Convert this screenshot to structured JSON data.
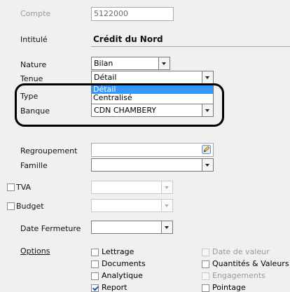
{
  "labels": {
    "compte": "Compte",
    "intitule": "Intitulé",
    "nature": "Nature",
    "tenue": "Tenue",
    "type": "Type",
    "banque": "Banque",
    "regroupement": "Regroupement",
    "famille": "Famille",
    "tva": "TVA",
    "budget": "Budget",
    "date_fermeture": "Date Fermeture",
    "options": "Options"
  },
  "values": {
    "compte": "5122000",
    "intitule": "Crédit du Nord",
    "nature": "Bilan",
    "tenue": "Détail",
    "banque": "CDN CHAMBERY"
  },
  "tenue_options": [
    "Détail",
    "Centralisé"
  ],
  "tenue_selected_index": 0,
  "options": [
    {
      "label": "Lettrage",
      "checked": false,
      "enabled": true
    },
    {
      "label": "Date de valeur",
      "checked": false,
      "enabled": false
    },
    {
      "label": "Documents",
      "checked": false,
      "enabled": true
    },
    {
      "label": "Quantités & Valeurs",
      "checked": false,
      "enabled": true
    },
    {
      "label": "Analytique",
      "checked": false,
      "enabled": true
    },
    {
      "label": "Engagements",
      "checked": false,
      "enabled": false
    },
    {
      "label": "Report",
      "checked": true,
      "enabled": true
    },
    {
      "label": "Pointage",
      "checked": false,
      "enabled": true
    }
  ],
  "colors": {
    "selection": "#3399ff",
    "checkmark": "#1a56c4"
  }
}
